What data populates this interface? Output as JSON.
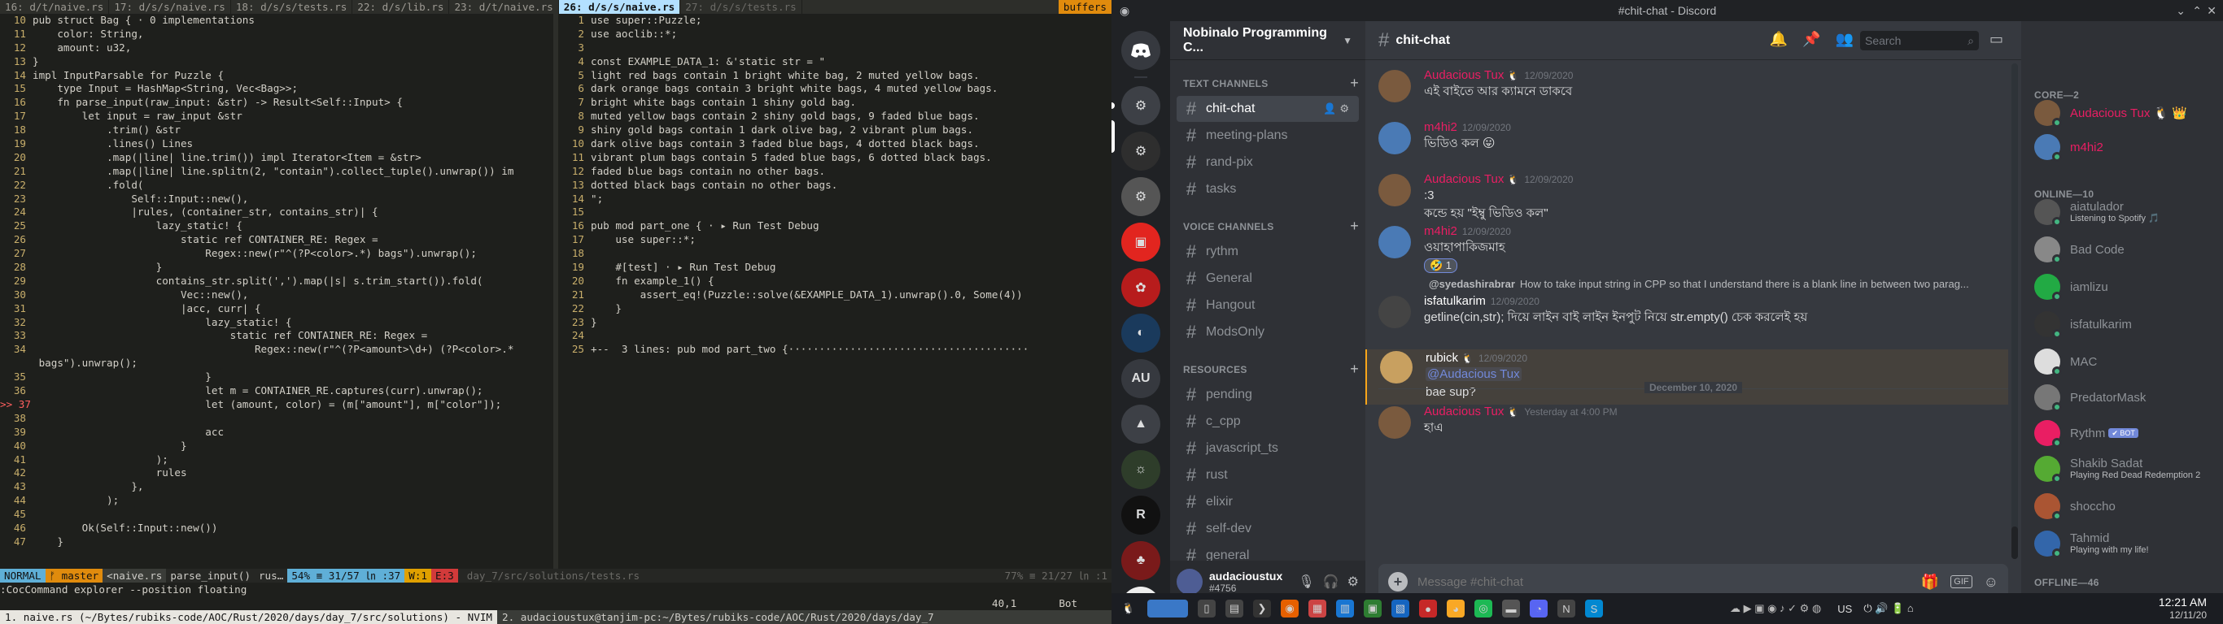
{
  "vim": {
    "tabs": [
      {
        "label": " 16: d/t/naive.rs ",
        "state": "normal"
      },
      {
        "label": " 17: d/s/s/naive.rs ",
        "state": "normal"
      },
      {
        "label": " 18: d/s/s/tests.rs ",
        "state": "normal"
      },
      {
        "label": " 22: d/s/lib.rs ",
        "state": "normal"
      },
      {
        "label": " 23: d/t/naive.rs ",
        "state": "normal"
      },
      {
        "label": " 26: d/s/s/naive.rs ",
        "state": "selected"
      },
      {
        "label": " 27: d/s/s/tests.rs ",
        "state": "dim"
      }
    ],
    "buffers_label": "buffers",
    "left": [
      {
        "n": "10",
        "t": "pub struct Bag { · 0 implementations"
      },
      {
        "n": "11",
        "t": "    color: String,"
      },
      {
        "n": "12",
        "t": "    amount: u32,"
      },
      {
        "n": "13",
        "t": "}"
      },
      {
        "n": "14",
        "t": "impl InputParsable for Puzzle {"
      },
      {
        "n": "15",
        "t": "    type Input = HashMap<String, Vec<Bag>>;"
      },
      {
        "n": "16",
        "t": "    fn parse_input(raw_input: &str) -> Result<Self::Input> {"
      },
      {
        "n": "17",
        "t": "        let input = raw_input &str"
      },
      {
        "n": "18",
        "t": "            .trim() &str"
      },
      {
        "n": "19",
        "t": "            .lines() Lines"
      },
      {
        "n": "20",
        "t": "            .map(|line| line.trim()) impl Iterator<Item = &str>"
      },
      {
        "n": "21",
        "t": "            .map(|line| line.splitn(2, \"contain\").collect_tuple().unwrap()) im"
      },
      {
        "n": "22",
        "t": "            .fold("
      },
      {
        "n": "23",
        "t": "                Self::Input::new(),"
      },
      {
        "n": "24",
        "t": "                |rules, (container_str, contains_str)| {"
      },
      {
        "n": "25",
        "t": "                    lazy_static! {"
      },
      {
        "n": "26",
        "t": "                        static ref CONTAINER_RE: Regex ="
      },
      {
        "n": "27",
        "t": "                            Regex::new(r\"^(?P<color>.*) bags\").unwrap();"
      },
      {
        "n": "28",
        "t": "                    }"
      },
      {
        "n": "29",
        "t": "                    contains_str.split(',').map(|s| s.trim_start()).fold("
      },
      {
        "n": "30",
        "t": "                        Vec::new(),"
      },
      {
        "n": "31",
        "t": "                        |acc, curr| {"
      },
      {
        "n": "32",
        "t": "                            lazy_static! {"
      },
      {
        "n": "33",
        "t": "                                static ref CONTAINER_RE: Regex ="
      },
      {
        "n": "34",
        "t": "                                    Regex::new(r\"^(?P<amount>\\d+) (?P<color>.*"
      },
      {
        "n": "",
        "t": " bags\").unwrap();"
      },
      {
        "n": "35",
        "t": "                            }"
      },
      {
        "n": "36",
        "t": "                            let m = CONTAINER_RE.captures(curr).unwrap();"
      },
      {
        "n": ">> 37",
        "t": "                            let (amount, color) = (m[\"amount\"], m[\"color\"]);"
      },
      {
        "n": "38",
        "t": ""
      },
      {
        "n": "39",
        "t": "                            acc"
      },
      {
        "n": "40",
        "t": "                        }"
      },
      {
        "n": "41",
        "t": "                    );"
      },
      {
        "n": "42",
        "t": "                    rules"
      },
      {
        "n": "43",
        "t": "                },"
      },
      {
        "n": "44",
        "t": "            );"
      },
      {
        "n": "45",
        "t": ""
      },
      {
        "n": "46",
        "t": "        Ok(Self::Input::new())"
      },
      {
        "n": "47",
        "t": "    }"
      }
    ],
    "right": [
      {
        "n": "1",
        "t": "use super::Puzzle;"
      },
      {
        "n": "2",
        "t": "use aoclib::*;"
      },
      {
        "n": "3",
        "t": ""
      },
      {
        "n": "4",
        "t": "const EXAMPLE_DATA_1: &'static str = \""
      },
      {
        "n": "5",
        "t": "light red bags contain 1 bright white bag, 2 muted yellow bags."
      },
      {
        "n": "6",
        "t": "dark orange bags contain 3 bright white bags, 4 muted yellow bags."
      },
      {
        "n": "7",
        "t": "bright white bags contain 1 shiny gold bag."
      },
      {
        "n": "8",
        "t": "muted yellow bags contain 2 shiny gold bags, 9 faded blue bags."
      },
      {
        "n": "9",
        "t": "shiny gold bags contain 1 dark olive bag, 2 vibrant plum bags."
      },
      {
        "n": "10",
        "t": "dark olive bags contain 3 faded blue bags, 4 dotted black bags."
      },
      {
        "n": "11",
        "t": "vibrant plum bags contain 5 faded blue bags, 6 dotted black bags."
      },
      {
        "n": "12",
        "t": "faded blue bags contain no other bags."
      },
      {
        "n": "13",
        "t": "dotted black bags contain no other bags."
      },
      {
        "n": "14",
        "t": "\";"
      },
      {
        "n": "15",
        "t": ""
      },
      {
        "n": "16",
        "t": "pub mod part_one { · ▸ Run Test Debug"
      },
      {
        "n": "17",
        "t": "    use super::*;"
      },
      {
        "n": "18",
        "t": ""
      },
      {
        "n": "19",
        "t": "    #[test] · ▸ Run Test Debug"
      },
      {
        "n": "20",
        "t": "    fn example_1() {"
      },
      {
        "n": "21",
        "t": "        assert_eq!(Puzzle::solve(&EXAMPLE_DATA_1).unwrap().0, Some(4))"
      },
      {
        "n": "22",
        "t": "    }"
      },
      {
        "n": "23",
        "t": "}"
      },
      {
        "n": "24",
        "t": ""
      },
      {
        "n": "25",
        "t": "+--  3 lines: pub mod part_two {·······································"
      }
    ],
    "status_left": [
      {
        "t": " NORMAL ",
        "bg": "#5fafd7",
        "fg": "#111"
      },
      {
        "t": " ᚠ master ",
        "bg": "#e08b0d",
        "fg": "#111"
      },
      {
        "t": " <naive.rs ",
        "bg": "#3a3c38",
        "fg": "#cfcdc8"
      },
      {
        "t": " parse_input() ",
        "bg": "#262724",
        "fg": "#cfcdc8"
      },
      {
        "t": " rus… ",
        "bg": "#262724",
        "fg": "#cfcdc8"
      },
      {
        "t": " 54% ≡ 31/57 ㏑ :37 ",
        "bg": "#5fafd7",
        "fg": "#111"
      },
      {
        "t": " W:1 ",
        "bg": "#e0a000",
        "fg": "#111"
      },
      {
        "t": " E:3 ",
        "bg": "#d23a3a",
        "fg": "#111"
      }
    ],
    "status_right": [
      {
        "t": " day_7/src/solutions/tests.rs ",
        "bg": "#262724",
        "fg": "#6b6a66"
      },
      {
        "t": " 77% ≡ 21/27 ㏑ :1 ",
        "bg": "#262724",
        "fg": "#6b6a66"
      }
    ],
    "cmd": ":CocCommand explorer --position floating",
    "ruler_pos": "40,1",
    "ruler_pct": "Bot"
  },
  "tmux": {
    "windows": [
      {
        "label": "1. naive.rs (~/Bytes/rubiks-code/AOC/Rust/2020/days/day_7/src/solutions) - NVIM",
        "active": true
      },
      {
        "label": "2. audacioustux@tanjim-pc:~/Bytes/rubiks-code/AOC/Rust/2020/days/day_7",
        "active": false
      }
    ]
  },
  "discord": {
    "window_title": "#chit-chat - Discord",
    "server_name": "Nobinalo Programming C...",
    "categories": {
      "text": "TEXT CHANNELS",
      "voice": "VOICE CHANNELS",
      "resources": "RESOURCES"
    },
    "text_channels": [
      "chit-chat",
      "meeting-plans",
      "rand-pix",
      "tasks"
    ],
    "voice_channels": [
      "rythm",
      "General",
      "Hangout",
      "ModsOnly"
    ],
    "resource_channels": [
      "pending",
      "c_cpp",
      "javascript_ts",
      "rust",
      "elixir",
      "self-dev",
      "general"
    ],
    "guild_au_label": "AU",
    "user": {
      "name": "audacioustux",
      "tag": "#4756"
    },
    "channel_title": "chit-chat",
    "search_placeholder": "Search",
    "composer_placeholder": "Message #chit-chat",
    "messages": [
      {
        "author": "Audacious Tux",
        "badge": "🐧",
        "ts": "12/09/2020",
        "text": "এই বাইতে আর ক্যামনে ডাকবে",
        "color": "#e91e63"
      },
      {
        "author": "m4hi2",
        "badge": "",
        "ts": "12/09/2020",
        "text": "ভিডিও কল 😛",
        "color": "#e91e63"
      },
      {
        "author": "Audacious Tux",
        "badge": "🐧",
        "ts": "12/09/2020",
        "text": ":3",
        "text2": "কন্ডে হয় \"ইম্বু ভিডিও কল\"",
        "color": "#e91e63"
      },
      {
        "author": "m4hi2",
        "badge": "",
        "ts": "12/09/2020",
        "text": "ওয়াহাপাকিজমাহ",
        "reaction": "🤣 1",
        "color": "#e91e63"
      },
      {
        "author": "isfatulkarim",
        "badge": "",
        "ts": "12/09/2020",
        "text": "getline(cin,str); দিয়ে লাইন বাই লাইন ইনপুট নিয়ে str.empty() চেক করলেই হয়",
        "color": "#ffffff",
        "reply_author": "@syedashirabrar",
        "reply_text": "How to take input string in CPP so that I understand there is a blank line in between two parag..."
      },
      {
        "author": "rubick",
        "badge": "🐧",
        "ts": "12/09/2020",
        "mention": "@Audacious Tux",
        "text": "bae sup?",
        "color": "#ffffff"
      },
      {
        "author": "Audacious Tux",
        "badge": "🐧",
        "ts": "Yesterday at 4:00 PM",
        "text": "হাএ",
        "color": "#e91e63"
      }
    ],
    "divider": "December 10, 2020",
    "members": {
      "core_label": "CORE—2",
      "online_label": "ONLINE—10",
      "offline_label": "OFFLINE—46",
      "core": [
        {
          "name": "Audacious Tux 🐧 👑",
          "status": ""
        },
        {
          "name": "m4hi2",
          "status": ""
        }
      ],
      "online": [
        {
          "name": "aiatulador",
          "status": "Listening to Spotify 🎵"
        },
        {
          "name": "Bad Code",
          "status": ""
        },
        {
          "name": "iamlizu",
          "status": ""
        },
        {
          "name": "isfatulkarim",
          "status": ""
        },
        {
          "name": "MAC",
          "status": ""
        },
        {
          "name": "PredatorMask",
          "status": ""
        },
        {
          "name": "Rythm",
          "status": "",
          "bot": "✔ BOT"
        },
        {
          "name": "Shakib Sadat",
          "status": "Playing Red Dead Redemption 2"
        },
        {
          "name": "shoccho",
          "status": ""
        },
        {
          "name": "Tahmid",
          "status": "Playing with my life!"
        }
      ]
    }
  },
  "taskbar": {
    "time": "12:21 AM",
    "date": "12/11/20",
    "lang": "US"
  }
}
